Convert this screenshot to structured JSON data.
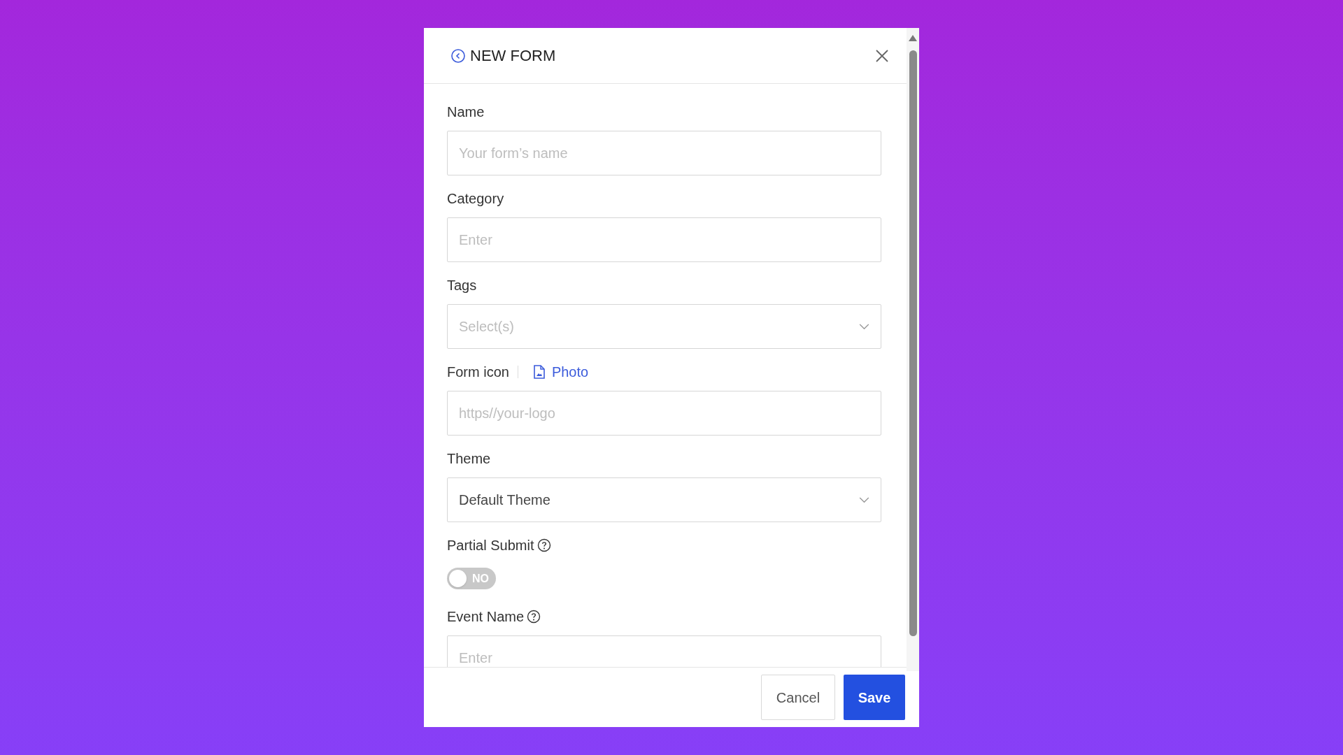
{
  "dialog": {
    "title": "NEW FORM"
  },
  "fields": [
    {
      "kind": "text",
      "label": "Name",
      "placeholder": "Your form’s name"
    },
    {
      "kind": "text",
      "label": "Category",
      "placeholder": "Enter"
    },
    {
      "kind": "select",
      "label": "Tags",
      "placeholder": "Select(s)"
    },
    {
      "kind": "text",
      "label": "Form icon",
      "link": "Photo",
      "placeholder": "https//your-logo"
    },
    {
      "kind": "select",
      "label": "Theme",
      "value": "Default Theme"
    },
    {
      "kind": "toggle",
      "label": "Partial Submit",
      "help": true,
      "on": false,
      "toggle_text": "NO"
    },
    {
      "kind": "text",
      "label": "Event Name",
      "help": true,
      "placeholder": "Enter"
    }
  ],
  "buttons": [
    {
      "label": "Cancel",
      "kind": "secondary"
    },
    {
      "label": "Save",
      "kind": "primary"
    }
  ]
}
